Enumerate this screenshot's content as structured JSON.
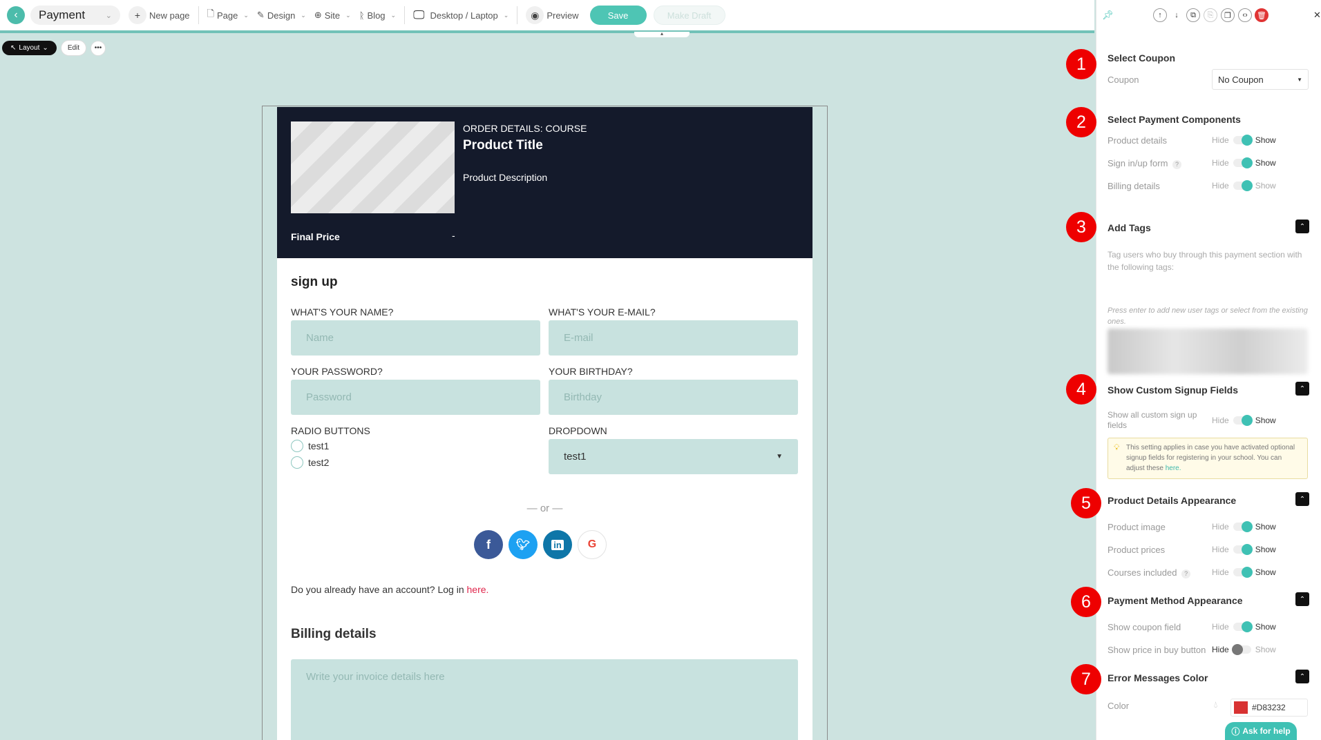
{
  "topbar": {
    "back_icon": "chevron-left-icon",
    "page_name": "Payment",
    "new_page": "New page",
    "page_menu": "Page",
    "design_menu": "Design",
    "site_menu": "Site",
    "blog_menu": "Blog",
    "device": "Desktop / Laptop",
    "preview": "Preview",
    "save": "Save",
    "make_draft": "Make Draft"
  },
  "layoutbar": {
    "layout": "Layout",
    "edit": "Edit",
    "more": "•••"
  },
  "product": {
    "order_details": "ORDER DETAILS: COURSE",
    "title": "Product Title",
    "description": "Product Description",
    "final_price_label": "Final Price",
    "final_price_value": "-"
  },
  "signup": {
    "heading": "sign up",
    "name_label": "WHAT'S YOUR NAME?",
    "name_placeholder": "Name",
    "email_label": "WHAT'S YOUR E-MAIL?",
    "email_placeholder": "E-mail",
    "password_label": "YOUR PASSWORD?",
    "password_placeholder": "Password",
    "birthday_label": "YOUR BIRTHDAY?",
    "birthday_placeholder": "Birthday",
    "radio_label": "RADIO BUTTONS",
    "radio_options": [
      "test1",
      "test2"
    ],
    "dropdown_label": "DROPDOWN",
    "dropdown_value": "test1",
    "or_text": "— or —",
    "account_text": "Do you already have an account? Log in ",
    "account_link": "here."
  },
  "billing": {
    "heading": "Billing details",
    "placeholder": "Write your invoice details here"
  },
  "colors": {
    "accent": "#4ec5b4",
    "hero": "#141a2b",
    "facebook": "#3b5998",
    "twitter": "#1da1f2",
    "linkedin": "#0e76a8",
    "error": "#D83232"
  },
  "panel": {
    "select_coupon": "Select Coupon",
    "coupon_label": "Coupon",
    "coupon_value": "No Coupon",
    "payment_components": "Select Payment Components",
    "product_details": "Product details",
    "sign_form": "Sign in/up form",
    "billing_details": "Billing details",
    "hide": "Hide",
    "show": "Show",
    "add_tags": "Add Tags",
    "tags_desc": "Tag users who buy through this payment section with the following tags:",
    "tags_hint": "Press enter to add new user tags or select from the existing ones.",
    "custom_signup": "Show Custom Signup Fields",
    "show_all_custom": "Show all custom sign up fields",
    "note_text": "This setting applies in case you have activated optional signup fields for registering in your school. You can adjust these ",
    "note_link": "here.",
    "details_appearance": "Product Details Appearance",
    "product_image": "Product image",
    "product_prices": "Product prices",
    "courses_included": "Courses included",
    "method_appearance": "Payment Method Appearance",
    "show_coupon": "Show coupon field",
    "show_price": "Show price in buy button",
    "error_color": "Error Messages Color",
    "color_label": "Color",
    "color_value": "#D83232",
    "ask_help": "Ask for help"
  },
  "badges": [
    "1",
    "2",
    "3",
    "4",
    "5",
    "6",
    "7"
  ]
}
